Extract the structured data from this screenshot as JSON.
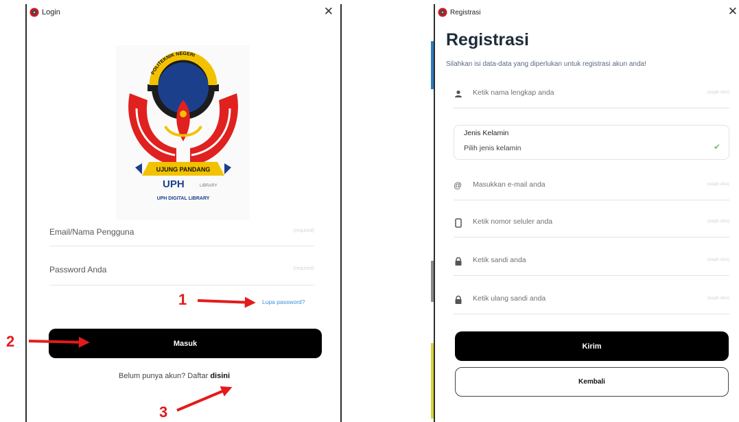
{
  "login": {
    "window_title": "Login",
    "close": "✕",
    "logo": {
      "ring_top_text": "POLITEKNIK NEGERI",
      "ribbon_text": "UJUNG PANDANG",
      "under_brand": "UPH",
      "under_small": "LIBRARY",
      "under_caption": "UPH DIGITAL LIBRARY"
    },
    "email_placeholder": "Email/Nama Pengguna",
    "email_hint": "(required)",
    "password_placeholder": "Password Anda",
    "password_hint": "(required)",
    "forgot_link": "Lupa password?",
    "submit_label": "Masuk",
    "signup_text": "Belum punya akun? Daftar",
    "signup_link": "disini"
  },
  "annotations": {
    "num1": "1",
    "num2": "2",
    "num3": "3",
    "color": "#e31b1b"
  },
  "register": {
    "window_title": "Registrasi",
    "close": "✕",
    "heading": "Registrasi",
    "subheading": "Silahkan isi data-data yang diperlukan untuk registrasi akun anda!",
    "fields": {
      "name": {
        "placeholder": "Ketik nama lengkap anda",
        "hint": "(wajib diisi)",
        "icon": "person-icon"
      },
      "email": {
        "placeholder": "Masukkan e-mail anda",
        "hint": "(wajib diisi)",
        "icon": "at-icon"
      },
      "phone": {
        "placeholder": "Ketik nomor seluler anda",
        "hint": "(wajib diisi)",
        "icon": "phone-icon"
      },
      "password": {
        "placeholder": "Ketik sandi anda",
        "hint": "(wajib diisi)",
        "icon": "lock-icon"
      },
      "password_confirm": {
        "placeholder": "Ketik ulang sandi anda",
        "hint": "(wajib diisi)",
        "icon": "lock-icon"
      }
    },
    "gender": {
      "label": "Jenis Kelamin",
      "value": "Pilih jenis kelamin",
      "icon": "check-icon"
    },
    "submit_label": "Kirim",
    "back_label": "Kembali"
  }
}
